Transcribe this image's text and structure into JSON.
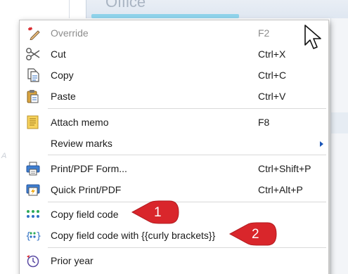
{
  "background": {
    "header_title": "Office"
  },
  "menu": {
    "items": [
      {
        "label": "Override",
        "shortcut": "F2",
        "icon": "override-icon",
        "enabled": false
      },
      {
        "label": "Cut",
        "shortcut": "Ctrl+X",
        "icon": "scissors-icon",
        "enabled": true
      },
      {
        "label": "Copy",
        "shortcut": "Ctrl+C",
        "icon": "copy-icon",
        "enabled": true
      },
      {
        "label": "Paste",
        "shortcut": "Ctrl+V",
        "icon": "paste-icon",
        "enabled": true
      },
      {
        "label": "Attach memo",
        "shortcut": "F8",
        "icon": "memo-icon",
        "enabled": true
      },
      {
        "label": "Review marks",
        "shortcut": "",
        "icon": "",
        "enabled": true,
        "has_submenu": true
      },
      {
        "label": "Print/PDF Form...",
        "shortcut": "Ctrl+Shift+P",
        "icon": "printer-icon",
        "enabled": true
      },
      {
        "label": "Quick Print/PDF",
        "shortcut": "Ctrl+Alt+P",
        "icon": "quick-print-icon",
        "enabled": true
      },
      {
        "label": "Copy field code",
        "shortcut": "",
        "icon": "dots-icon",
        "enabled": true
      },
      {
        "label": "Copy field code with {{curly brackets}}",
        "shortcut": "",
        "icon": "curly-brackets-icon",
        "enabled": true
      },
      {
        "label": "Prior year",
        "shortcut": "",
        "icon": "clock-icon",
        "enabled": true
      }
    ]
  },
  "callouts": [
    {
      "number": "1",
      "target": "Copy field code"
    },
    {
      "number": "2",
      "target": "Copy field code with {{curly brackets}}"
    }
  ],
  "colors": {
    "callout_red": "#d9262b",
    "submenu_arrow": "#1b56b8",
    "disabled_text": "#8d8d8d",
    "icon_blue": "#2f6fc4",
    "icon_green": "#2eaa5a"
  }
}
